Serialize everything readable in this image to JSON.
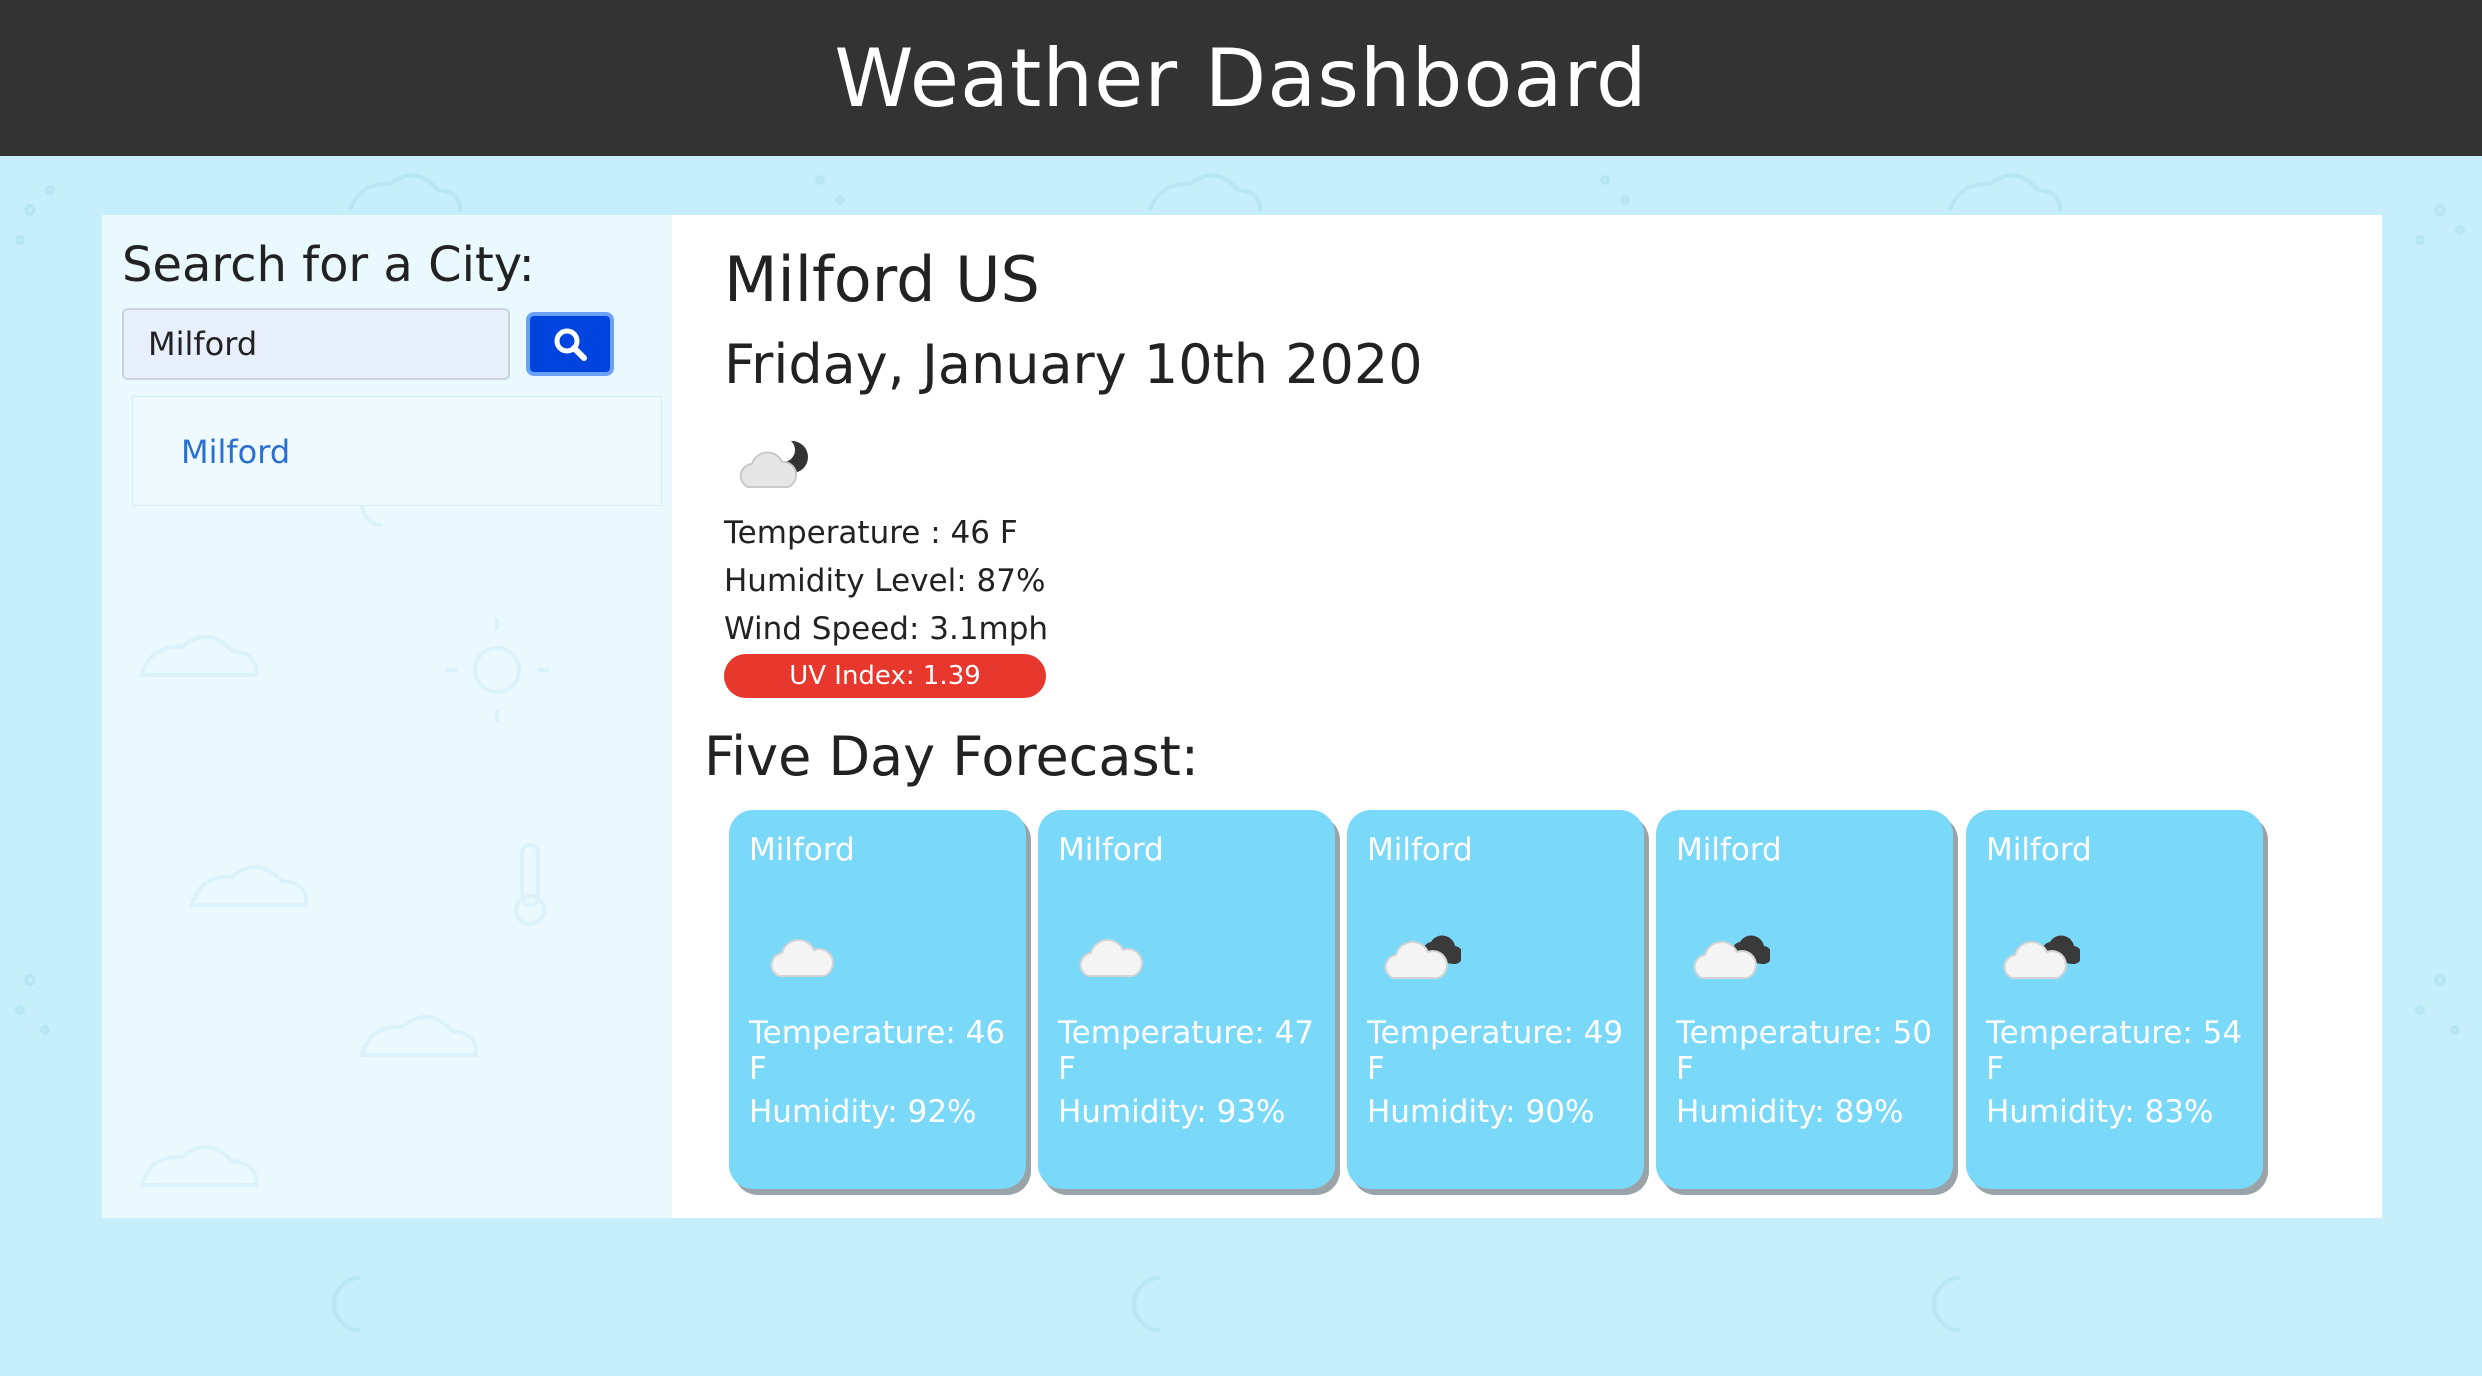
{
  "header": {
    "title": "Weather Dashboard"
  },
  "sidebar": {
    "search_title": "Search for a City:",
    "search_value": "Milford",
    "history": [
      "Milford"
    ]
  },
  "current": {
    "city": "Milford US",
    "date": "Friday, January 10th 2020",
    "icon": "cloud-night-icon",
    "temperature": "Temperature : 46 F",
    "humidity": "Humidity Level: 87%",
    "wind": "Wind Speed: 3.1mph",
    "uv": "UV Index: 1.39"
  },
  "forecast": {
    "title": "Five Day Forecast:",
    "days": [
      {
        "city": "Milford",
        "icon": "cloud-icon",
        "temperature": "Temperature: 46 F",
        "humidity": "Humidity: 92%"
      },
      {
        "city": "Milford",
        "icon": "cloud-icon",
        "temperature": "Temperature: 47 F",
        "humidity": "Humidity: 93%"
      },
      {
        "city": "Milford",
        "icon": "broken-clouds-icon",
        "temperature": "Temperature: 49 F",
        "humidity": "Humidity: 90%"
      },
      {
        "city": "Milford",
        "icon": "broken-clouds-icon",
        "temperature": "Temperature: 50 F",
        "humidity": "Humidity: 89%"
      },
      {
        "city": "Milford",
        "icon": "broken-clouds-icon",
        "temperature": "Temperature: 54 F",
        "humidity": "Humidity: 83%"
      }
    ]
  },
  "colors": {
    "header_bg": "#333333",
    "page_bg": "#c6eefb",
    "search_button": "#0044e0",
    "uv_badge": "#e8372c",
    "card_bg": "#7ad8f9",
    "link": "#2a6fd1"
  }
}
